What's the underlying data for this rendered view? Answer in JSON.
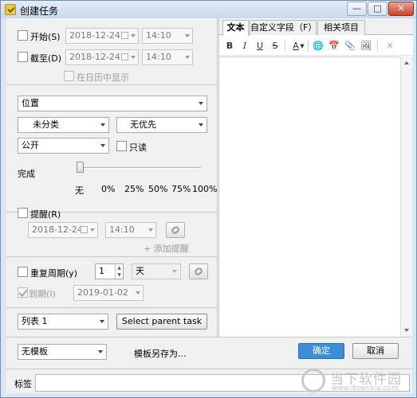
{
  "window": {
    "title": "创建任务",
    "controls": {
      "minimize": "—",
      "maximize": "□",
      "close": "✕"
    }
  },
  "dates": {
    "start": {
      "label": "开始(S)",
      "date": "2018-12-24",
      "time": "14:10",
      "checked": false
    },
    "due": {
      "label": "截至(D)",
      "date": "2018-12-24",
      "time": "14:10",
      "checked": false
    },
    "show_in_calendar": {
      "label": "在日历中显示",
      "checked": false
    }
  },
  "properties": {
    "location": "位置",
    "category": "未分类",
    "priority": "无优先",
    "visibility": "公开",
    "readonly_label": "只读"
  },
  "progress": {
    "label": "完成",
    "value": 0,
    "ticks": [
      "无",
      "0%",
      "25%",
      "50%",
      "75%",
      "100%"
    ]
  },
  "reminder": {
    "label": "提醒(R)",
    "date": "2018-12-24",
    "time": "14:10",
    "add_label": "+ 添加提醒"
  },
  "recurrence": {
    "label": "重复周期(y)",
    "interval": "1",
    "unit": "天",
    "until_label": "到期(I)",
    "until_date": "2019-01-02"
  },
  "list": {
    "selected": "列表 1",
    "parent_button": "Select parent task"
  },
  "editor": {
    "tabs": [
      "文本",
      "自定义字段（F）",
      "相关项目"
    ],
    "toolbar": [
      {
        "icon": "bold-icon",
        "glyph": "B"
      },
      {
        "icon": "italic-icon",
        "glyph": "I"
      },
      {
        "icon": "underline-icon",
        "glyph": "U"
      },
      {
        "icon": "strikethrough-icon",
        "glyph": "S"
      },
      {
        "icon": "font-color-icon",
        "glyph": "A"
      },
      {
        "icon": "link-icon",
        "glyph": "🌐"
      },
      {
        "icon": "insert-date-icon",
        "glyph": "📅"
      },
      {
        "icon": "attach-icon",
        "glyph": "📎"
      },
      {
        "icon": "insert-image-icon",
        "glyph": "🖼"
      },
      {
        "icon": "clear-icon",
        "glyph": "✕"
      }
    ]
  },
  "footer": {
    "template": "无模板",
    "save_template": "模板另存为...",
    "ok": "确定",
    "cancel": "取消",
    "tags_label": "标签"
  },
  "watermark": {
    "text": "当下软件园",
    "url": "www.downxia.com"
  },
  "colors": {
    "primary": "#3c8fd6",
    "title_bar": "#c8d8ec",
    "panel": "#f0f0f0"
  }
}
